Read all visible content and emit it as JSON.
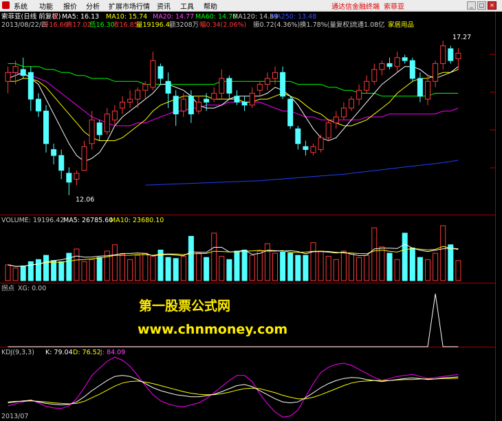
{
  "menu": {
    "items": [
      "系统",
      "功能",
      "报价",
      "分析",
      "扩展市场行情",
      "资讯",
      "工具",
      "帮助"
    ],
    "brand": "通达信金融终端",
    "stock": "索菲亚"
  },
  "header": {
    "row1": {
      "name": "索菲亚(日线 前复权)",
      "ma5": "MA5: 16.13",
      "ma10": "MA10: 15.74",
      "ma20": "MA20: 14.77",
      "ma60": "MA60: 14.76",
      "ma120": "MA120: 14.89",
      "ma250": "MA250: 13.48"
    },
    "row2": {
      "date": "2013/08/22/四",
      "open": "开16.66",
      "high": "高17.02",
      "low": "低16.30",
      "close": "收16.85",
      "volume": "量19196.4",
      "amount": "额3208万",
      "change": "幅0.34(2.06%)",
      "amplitude": "振0.72(4.36%)",
      "turnover": "换1.78%(量复权)",
      "float": "流通1.08亿",
      "industry": "家居用品"
    }
  },
  "price_panel": {
    "high_label": "17.27",
    "low_label": "12.06"
  },
  "volume_panel": {
    "vol": "VOLUME: 19196.42",
    "ma5": "MA5: 26785.60",
    "ma10": "MA10: 23680.10"
  },
  "indicator_panel": {
    "title": "拐点",
    "xg": "XG: 0.00"
  },
  "kdj_panel": {
    "name": "KDJ(9,3,3)",
    "k": "K: 79.04",
    "d": "D: 76.52",
    "j": "J: 84.09"
  },
  "watermark": {
    "line1": "第一股票公式网",
    "line2": "www.chnmoney.com"
  },
  "bottom_date": "2013/07",
  "colors": {
    "up": "#ff3a3a",
    "down": "#54ffff",
    "ma5": "#ffffff",
    "ma10": "#ffff00",
    "ma20": "#ff00ff",
    "ma60": "#00ff00",
    "ma250": "#2040ff"
  },
  "chart_data": {
    "type": "candlestick",
    "candles": [
      {
        "o": 15.9,
        "h": 16.4,
        "l": 15.5,
        "c": 16.2
      },
      {
        "o": 16.2,
        "h": 16.6,
        "l": 15.8,
        "c": 16.4
      },
      {
        "o": 16.3,
        "h": 16.7,
        "l": 16.0,
        "c": 16.1
      },
      {
        "o": 16.2,
        "h": 16.4,
        "l": 14.9,
        "c": 15.3
      },
      {
        "o": 15.3,
        "h": 15.5,
        "l": 14.7,
        "c": 14.9
      },
      {
        "o": 14.9,
        "h": 15.1,
        "l": 13.5,
        "c": 13.8
      },
      {
        "o": 13.6,
        "h": 13.8,
        "l": 13.1,
        "c": 13.4
      },
      {
        "o": 13.4,
        "h": 13.6,
        "l": 12.6,
        "c": 12.9
      },
      {
        "o": 12.8,
        "h": 13.0,
        "l": 12.06,
        "c": 12.5
      },
      {
        "o": 12.6,
        "h": 12.9,
        "l": 12.4,
        "c": 12.8
      },
      {
        "o": 12.9,
        "h": 13.9,
        "l": 12.9,
        "c": 13.7
      },
      {
        "o": 13.8,
        "h": 14.9,
        "l": 13.6,
        "c": 14.6
      },
      {
        "o": 14.5,
        "h": 14.6,
        "l": 13.9,
        "c": 14.1
      },
      {
        "o": 14.2,
        "h": 15.0,
        "l": 14.1,
        "c": 14.8
      },
      {
        "o": 14.6,
        "h": 15.1,
        "l": 14.4,
        "c": 14.9
      },
      {
        "o": 15.0,
        "h": 15.4,
        "l": 14.8,
        "c": 15.2
      },
      {
        "o": 15.2,
        "h": 15.6,
        "l": 15.0,
        "c": 15.3
      },
      {
        "o": 15.3,
        "h": 15.7,
        "l": 15.0,
        "c": 15.6
      },
      {
        "o": 15.6,
        "h": 15.9,
        "l": 15.3,
        "c": 15.8
      },
      {
        "o": 15.7,
        "h": 16.9,
        "l": 15.6,
        "c": 16.6
      },
      {
        "o": 16.4,
        "h": 16.5,
        "l": 15.8,
        "c": 16.0
      },
      {
        "o": 15.9,
        "h": 16.2,
        "l": 15.0,
        "c": 15.5
      },
      {
        "o": 15.4,
        "h": 15.6,
        "l": 14.4,
        "c": 14.8
      },
      {
        "o": 14.9,
        "h": 15.5,
        "l": 14.7,
        "c": 15.3
      },
      {
        "o": 15.4,
        "h": 15.6,
        "l": 14.5,
        "c": 14.8
      },
      {
        "o": 14.9,
        "h": 15.4,
        "l": 14.8,
        "c": 15.2
      },
      {
        "o": 15.3,
        "h": 15.5,
        "l": 14.9,
        "c": 15.2
      },
      {
        "o": 15.3,
        "h": 15.7,
        "l": 15.2,
        "c": 15.5
      },
      {
        "o": 15.5,
        "h": 16.3,
        "l": 15.3,
        "c": 16.0
      },
      {
        "o": 16.0,
        "h": 16.1,
        "l": 15.3,
        "c": 15.5
      },
      {
        "o": 15.4,
        "h": 15.6,
        "l": 15.1,
        "c": 15.2
      },
      {
        "o": 15.2,
        "h": 15.4,
        "l": 14.9,
        "c": 15.1
      },
      {
        "o": 15.1,
        "h": 15.7,
        "l": 15.0,
        "c": 15.5
      },
      {
        "o": 15.6,
        "h": 15.9,
        "l": 15.4,
        "c": 15.8
      },
      {
        "o": 15.8,
        "h": 16.2,
        "l": 15.6,
        "c": 16.0
      },
      {
        "o": 16.0,
        "h": 16.4,
        "l": 15.8,
        "c": 16.2
      },
      {
        "o": 16.2,
        "h": 16.4,
        "l": 15.3,
        "c": 15.4
      },
      {
        "o": 15.3,
        "h": 15.4,
        "l": 14.3,
        "c": 14.4
      },
      {
        "o": 14.3,
        "h": 14.4,
        "l": 13.6,
        "c": 13.8
      },
      {
        "o": 13.7,
        "h": 13.9,
        "l": 13.4,
        "c": 13.6
      },
      {
        "o": 13.5,
        "h": 13.8,
        "l": 13.4,
        "c": 13.7
      },
      {
        "o": 13.6,
        "h": 14.1,
        "l": 13.5,
        "c": 14.0
      },
      {
        "o": 14.0,
        "h": 14.6,
        "l": 13.9,
        "c": 14.5
      },
      {
        "o": 14.5,
        "h": 14.9,
        "l": 14.3,
        "c": 14.7
      },
      {
        "o": 14.7,
        "h": 15.2,
        "l": 14.6,
        "c": 15.0
      },
      {
        "o": 15.0,
        "h": 15.4,
        "l": 14.9,
        "c": 15.3
      },
      {
        "o": 15.3,
        "h": 15.8,
        "l": 15.1,
        "c": 15.6
      },
      {
        "o": 15.6,
        "h": 16.1,
        "l": 15.5,
        "c": 15.9
      },
      {
        "o": 15.9,
        "h": 16.5,
        "l": 15.8,
        "c": 16.3
      },
      {
        "o": 16.3,
        "h": 16.6,
        "l": 16.1,
        "c": 16.5
      },
      {
        "o": 16.5,
        "h": 16.7,
        "l": 16.3,
        "c": 16.4
      },
      {
        "o": 16.4,
        "h": 16.9,
        "l": 16.2,
        "c": 16.7
      },
      {
        "o": 16.7,
        "h": 16.8,
        "l": 16.5,
        "c": 16.6
      },
      {
        "o": 16.6,
        "h": 16.7,
        "l": 15.9,
        "c": 16.0
      },
      {
        "o": 16.0,
        "h": 16.2,
        "l": 15.2,
        "c": 15.4
      },
      {
        "o": 15.3,
        "h": 16.1,
        "l": 15.1,
        "c": 15.9
      },
      {
        "o": 15.9,
        "h": 16.6,
        "l": 15.7,
        "c": 16.5
      },
      {
        "o": 16.5,
        "h": 17.27,
        "l": 16.3,
        "c": 17.1
      },
      {
        "o": 17.0,
        "h": 17.1,
        "l": 16.5,
        "c": 16.6
      },
      {
        "o": 16.66,
        "h": 17.02,
        "l": 16.3,
        "c": 16.85
      }
    ],
    "volume": [
      1.5,
      1.2,
      1.4,
      1.8,
      2.0,
      2.4,
      1.9,
      1.8,
      2.6,
      3.0,
      1.8,
      2.0,
      2.2,
      2.8,
      3.4,
      2.5,
      2.0,
      2.4,
      2.6,
      2.3,
      2.9,
      2.2,
      2.1,
      2.3,
      4.2,
      2.6,
      2.2,
      4.5,
      2.3,
      2.0,
      2.8,
      2.9,
      2.4,
      2.8,
      3.5,
      2.6,
      2.7,
      2.6,
      2.4,
      2.4,
      3.6,
      2.8,
      2.3,
      2.0,
      2.8,
      2.6,
      2.2,
      2.4,
      5.0,
      3.2,
      2.6,
      2.0,
      4.5,
      3.1,
      2.2,
      2.0,
      2.6,
      5.2,
      3.4,
      1.9
    ],
    "xg_signal_index": 56,
    "ma5": [
      16.0,
      16.1,
      16.2,
      16.0,
      15.8,
      15.3,
      14.8,
      14.3,
      13.8,
      13.4,
      13.2,
      13.3,
      13.5,
      13.9,
      14.4,
      14.7,
      14.9,
      15.1,
      15.3,
      15.5,
      15.8,
      15.8,
      15.7,
      15.6,
      15.4,
      15.1,
      15.0,
      15.0,
      15.1,
      15.3,
      15.4,
      15.4,
      15.4,
      15.4,
      15.5,
      15.7,
      15.6,
      15.4,
      15.1,
      14.7,
      14.3,
      14.0,
      13.9,
      14.0,
      14.3,
      14.6,
      14.9,
      15.2,
      15.5,
      15.8,
      16.0,
      16.2,
      16.4,
      16.4,
      16.3,
      16.1,
      16.0,
      16.1,
      16.2,
      16.4
    ],
    "ma10": [
      15.9,
      15.9,
      16.0,
      16.0,
      15.9,
      15.7,
      15.4,
      15.1,
      14.8,
      14.5,
      14.2,
      14.0,
      13.9,
      13.9,
      13.9,
      14.0,
      14.2,
      14.4,
      14.6,
      14.9,
      15.1,
      15.2,
      15.3,
      15.4,
      15.4,
      15.4,
      15.4,
      15.3,
      15.3,
      15.3,
      15.3,
      15.2,
      15.2,
      15.3,
      15.3,
      15.4,
      15.5,
      15.4,
      15.3,
      15.1,
      14.9,
      14.8,
      14.6,
      14.5,
      14.4,
      14.4,
      14.5,
      14.6,
      14.8,
      15.0,
      15.2,
      15.5,
      15.7,
      15.9,
      16.0,
      16.0,
      16.1,
      16.2,
      16.2,
      16.3
    ],
    "ma20": [
      16.2,
      16.2,
      16.1,
      16.1,
      16.0,
      15.9,
      15.7,
      15.5,
      15.3,
      15.1,
      14.9,
      14.7,
      14.6,
      14.5,
      14.4,
      14.4,
      14.4,
      14.5,
      14.5,
      14.6,
      14.7,
      14.8,
      14.9,
      14.9,
      15.0,
      15.0,
      15.1,
      15.1,
      15.1,
      15.2,
      15.2,
      15.2,
      15.2,
      15.2,
      15.1,
      15.0,
      14.9,
      14.9,
      14.8,
      14.7,
      14.7,
      14.6,
      14.6,
      14.6,
      14.6,
      14.6,
      14.6,
      14.7,
      14.7,
      14.7,
      14.8,
      14.8,
      14.8,
      14.8,
      14.8,
      14.8,
      14.8,
      14.9,
      14.9,
      15.0
    ],
    "ma60": [
      16.5,
      16.5,
      16.4,
      16.4,
      16.4,
      16.3,
      16.3,
      16.2,
      16.2,
      16.1,
      16.1,
      16.0,
      16.0,
      16.0,
      15.9,
      15.9,
      15.9,
      15.9,
      15.8,
      15.8,
      15.8,
      15.8,
      15.8,
      15.8,
      15.8,
      15.8,
      15.8,
      15.8,
      15.9,
      15.9,
      15.9,
      15.9,
      15.9,
      15.9,
      15.9,
      15.9,
      15.9,
      15.9,
      15.8,
      15.8,
      15.8,
      15.8,
      15.7,
      15.7,
      15.6,
      15.6,
      15.5,
      15.5,
      15.5,
      15.4,
      15.4,
      15.4,
      15.4,
      15.4,
      15.4,
      15.4,
      15.5,
      15.5,
      15.5,
      15.5
    ],
    "ma250": [
      null,
      null,
      null,
      null,
      null,
      null,
      null,
      null,
      null,
      null,
      null,
      null,
      null,
      null,
      null,
      null,
      null,
      null,
      12.4,
      12.41,
      12.42,
      12.43,
      12.44,
      12.45,
      12.46,
      12.47,
      12.48,
      12.49,
      12.5,
      12.51,
      12.52,
      12.53,
      12.54,
      12.55,
      12.57,
      12.59,
      12.61,
      12.63,
      12.65,
      12.67,
      12.69,
      12.71,
      12.73,
      12.75,
      12.77,
      12.8,
      12.83,
      12.86,
      12.89,
      12.92,
      12.95,
      12.98,
      13.01,
      13.04,
      13.07,
      13.1,
      13.13,
      13.16,
      13.2,
      13.24
    ],
    "kdj_k": [
      28,
      30,
      32,
      33,
      30,
      27,
      25,
      24,
      25,
      30,
      40,
      52,
      62,
      72,
      80,
      82,
      80,
      74,
      66,
      58,
      52,
      48,
      44,
      42,
      40,
      40,
      42,
      45,
      50,
      56,
      62,
      64,
      60,
      52,
      44,
      36,
      30,
      28,
      30,
      38,
      48,
      58,
      66,
      72,
      76,
      78,
      77,
      74,
      72,
      70,
      72,
      74,
      76,
      77,
      76,
      74,
      75,
      77,
      78,
      79.04
    ],
    "kdj_d": [
      30,
      31,
      31,
      32,
      31,
      30,
      28,
      27,
      26,
      27,
      31,
      38,
      45,
      53,
      61,
      67,
      70,
      71,
      69,
      66,
      62,
      58,
      54,
      50,
      47,
      45,
      44,
      44,
      46,
      49,
      53,
      56,
      57,
      56,
      52,
      48,
      43,
      39,
      36,
      36,
      39,
      44,
      50,
      56,
      62,
      67,
      70,
      71,
      72,
      72,
      72,
      73,
      74,
      74,
      75,
      75,
      75,
      76,
      76,
      76.52
    ],
    "kdj_j": [
      22,
      26,
      30,
      34,
      28,
      21,
      18,
      17,
      22,
      36,
      58,
      82,
      96,
      110,
      118,
      112,
      100,
      82,
      62,
      44,
      32,
      26,
      22,
      20,
      24,
      28,
      36,
      48,
      60,
      72,
      82,
      82,
      70,
      46,
      26,
      10,
      0,
      2,
      14,
      40,
      66,
      88,
      98,
      104,
      106,
      102,
      94,
      86,
      78,
      72,
      76,
      80,
      82,
      84,
      80,
      76,
      78,
      80,
      82,
      84.09
    ]
  }
}
